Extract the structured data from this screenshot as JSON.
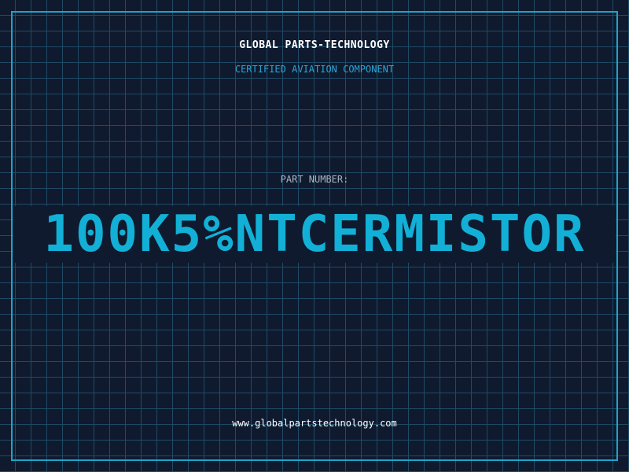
{
  "header": {
    "company": "GLOBAL PARTS-TECHNOLOGY",
    "subtitle": "CERTIFIED AVIATION COMPONENT"
  },
  "part": {
    "label": "PART NUMBER:",
    "number": "100K5%NTCERMISTOR"
  },
  "footer": {
    "url": "www.globalpartstechnology.com"
  },
  "colors": {
    "background": "#0f1a2e",
    "grid": "#1f4a66",
    "accent": "#1aa6c9",
    "part_number": "#12b0d6",
    "text": "#ffffff",
    "muted": "#aab3c2"
  }
}
